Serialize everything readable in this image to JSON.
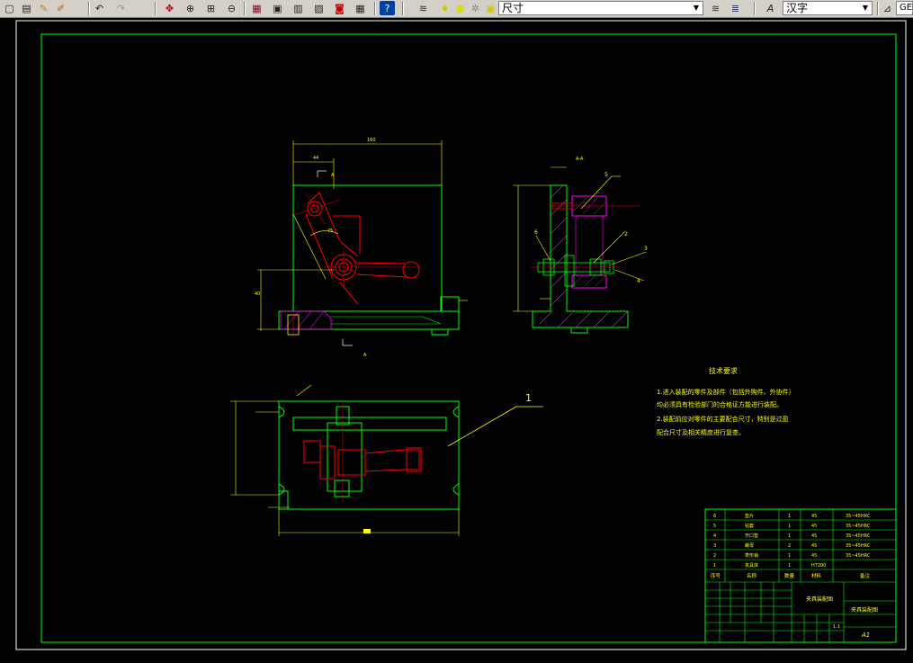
{
  "toolbar": {
    "icons": [
      "new-icon",
      "open-icon",
      "pencil-icon",
      "match-properties-icon",
      "undo-icon",
      "redo-icon",
      "pan-icon",
      "zoom-realtime-icon",
      "zoom-window-icon",
      "zoom-previous-icon",
      "properties-icon",
      "design-center-icon",
      "tool-palette-icon",
      "sheet-set-icon",
      "markup-icon",
      "calculator-icon",
      "help-icon",
      "layer-manager-icon",
      "bulb-icon",
      "sun-icon",
      "freeze-icon",
      "lock-icon"
    ],
    "layer_value": "尺寸",
    "text_style_value": "汉字",
    "dim_style_value": "GE"
  },
  "drawing": {
    "callout_1": "1",
    "section_label": "A",
    "section_view_label": "A-A",
    "tech_title": "技术要求",
    "tech_lines": [
      "1.进入装配的零件及部件（包括外购件、外协件）",
      "均必须具有检验部门的合格证方能进行装配。",
      "2.装配前应对零件的主要配合尺寸，特别是过盈",
      "配合尺寸及相关精度进行复查。"
    ],
    "part_callouts": [
      "5",
      "6",
      "2",
      "3",
      "4"
    ],
    "dims": {
      "width_top": "160",
      "width_left": "44",
      "height_right": "88",
      "r_left": "40",
      "angle": "75"
    }
  },
  "title_block": {
    "bom_rows": [
      {
        "no": "6",
        "name": "垫片",
        "qty": "1",
        "mat": "45",
        "note": "35~45HRC"
      },
      {
        "no": "5",
        "name": "钻套",
        "qty": "1",
        "mat": "45",
        "note": "35~45HRC"
      },
      {
        "no": "4",
        "name": "开口垫",
        "qty": "1",
        "mat": "45",
        "note": "35~45HRC"
      },
      {
        "no": "3",
        "name": "螺母",
        "qty": "2",
        "mat": "45",
        "note": "35~45HRC"
      },
      {
        "no": "2",
        "name": "菱形销",
        "qty": "1",
        "mat": "45",
        "note": "35~45HRC"
      },
      {
        "no": "1",
        "name": "夹具体",
        "qty": "1",
        "mat": "HT200",
        "note": ""
      }
    ],
    "bom_header": {
      "no": "序号",
      "name": "名称",
      "qty": "数量",
      "mat": "材料",
      "note": "备注"
    },
    "drawing_name": "夹具装配图",
    "drawing_title": "夹具装配图",
    "sheet_size": "A1",
    "scale": "1:1"
  },
  "colors": {
    "green": "#00ff00",
    "yellow": "#ffff00",
    "red": "#ff0000",
    "magenta": "#ff00ff",
    "white": "#ffffff",
    "cyan": "#00ffff"
  }
}
